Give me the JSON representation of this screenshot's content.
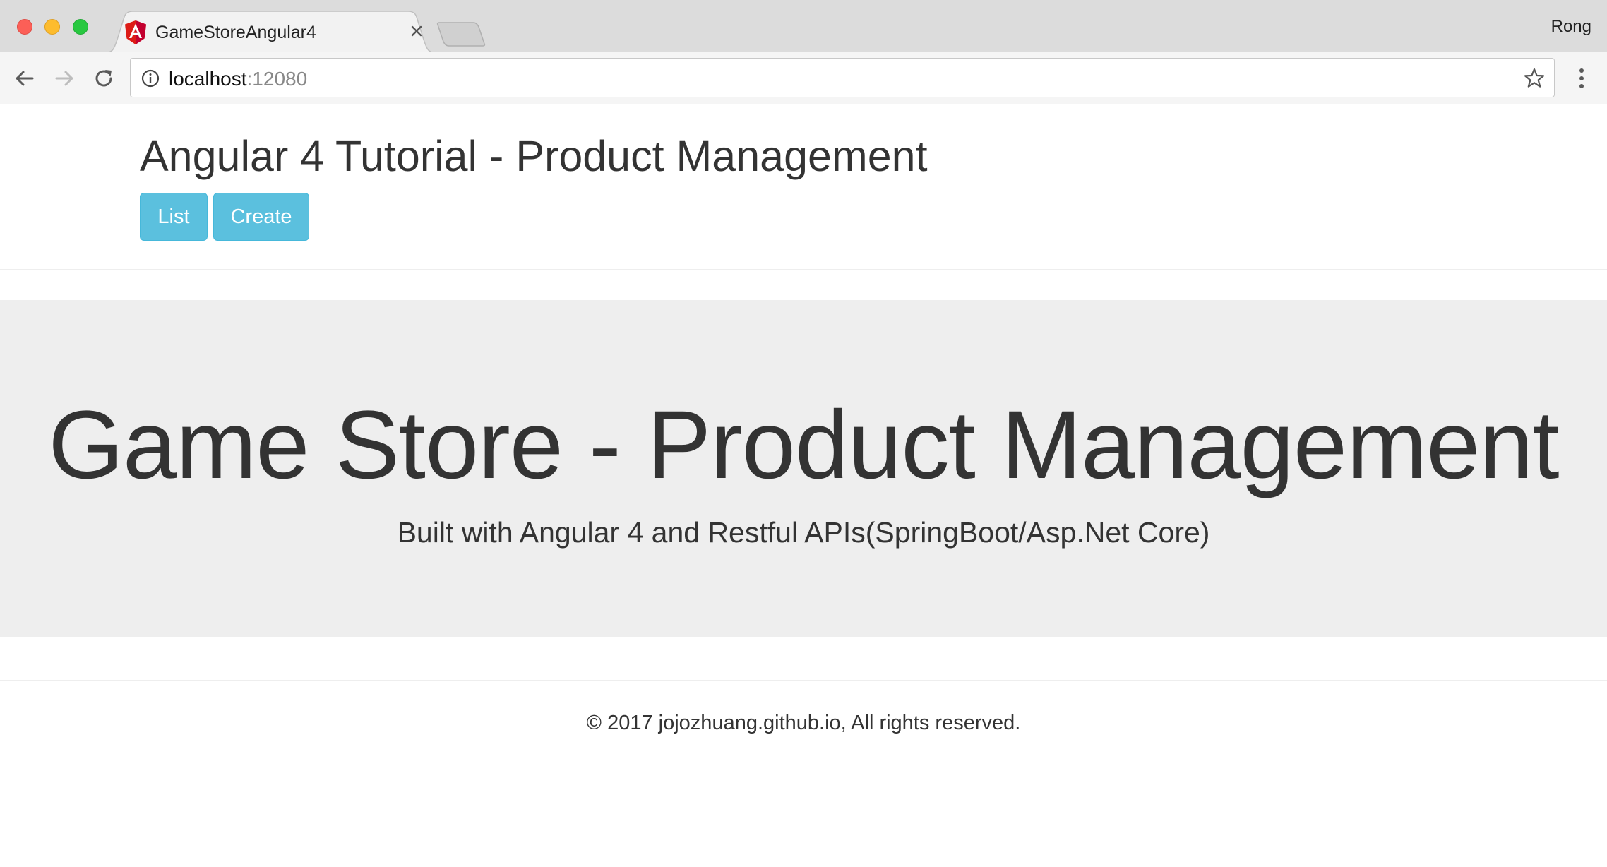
{
  "browser": {
    "tab": {
      "title": "GameStoreAngular4",
      "favicon": "angular-logo-icon",
      "favicon_color": "#dd1b16"
    },
    "profile_name": "Rong",
    "address_bar": {
      "host": "localhost",
      "port": ":12080"
    }
  },
  "header": {
    "title": "Angular 4 Tutorial - Product Management",
    "buttons": {
      "list_label": "List",
      "create_label": "Create"
    },
    "button_color": "#5bc0de"
  },
  "jumbotron": {
    "title": "Game Store - Product Management",
    "subtitle": "Built with Angular 4 and Restful APIs(SpringBoot/Asp.Net Core)",
    "background": "#eeeeee"
  },
  "footer": {
    "text": "© 2017 jojozhuang.github.io, All rights reserved."
  }
}
